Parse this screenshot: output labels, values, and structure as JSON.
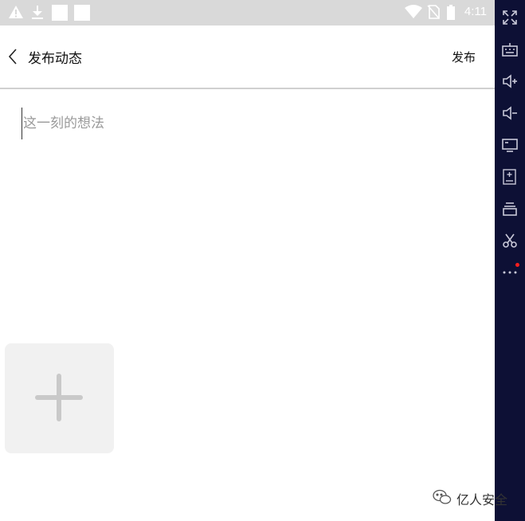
{
  "status_bar": {
    "time": "4:11",
    "icons": [
      "warning-icon",
      "download-icon",
      "notification-square-icon",
      "notification-square-icon",
      "wifi-icon",
      "no-sim-icon",
      "battery-icon"
    ]
  },
  "header": {
    "back_icon": "chevron-left-icon",
    "title": "发布动态",
    "publish_label": "发布"
  },
  "post_input": {
    "placeholder": "这一刻的想法",
    "value": ""
  },
  "add_photo": {
    "icon": "plus-icon"
  },
  "emulator_toolbar": {
    "items": [
      "fullscreen-icon",
      "keyboard-icon",
      "volume-up-icon",
      "volume-down-icon",
      "screen-icon",
      "install-apk-icon",
      "stack-icon",
      "scissors-icon",
      "more-icon"
    ],
    "dot_color": "#ff1e1e"
  },
  "watermark": {
    "text": "亿人安全"
  },
  "colors": {
    "status_bar": "#d9d9d9",
    "toolbar": "#0d1035",
    "add_tile": "#f1f1f1",
    "plus": "#c9c9c9",
    "placeholder": "#9a9a9a"
  }
}
